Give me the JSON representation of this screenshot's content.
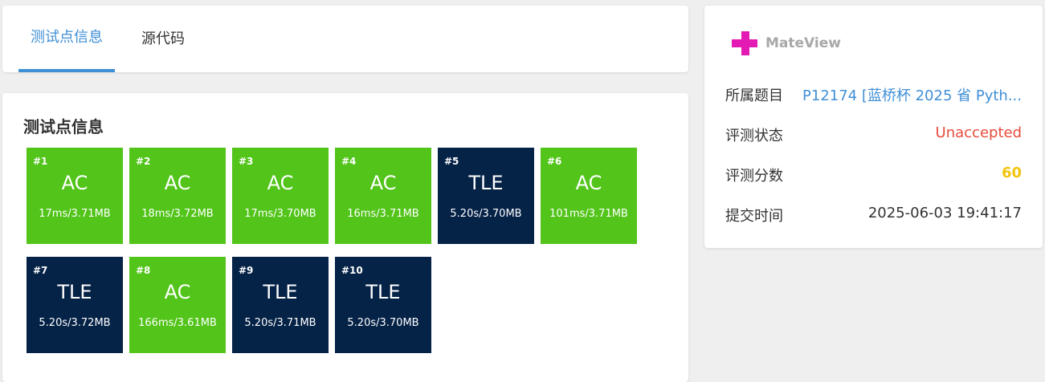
{
  "tabs": [
    {
      "label": "测试点信息",
      "active": true
    },
    {
      "label": "源代码",
      "active": false
    }
  ],
  "section_title": "测试点信息",
  "colors": {
    "ac": "#52c41a",
    "tle": "#052247",
    "accent": "#3f8fd6",
    "unaccepted": "#e74c3c",
    "score": "#f1c40f"
  },
  "test_cases": [
    {
      "num": "#1",
      "status": "AC",
      "meta": "17ms/3.71MB"
    },
    {
      "num": "#2",
      "status": "AC",
      "meta": "18ms/3.72MB"
    },
    {
      "num": "#3",
      "status": "AC",
      "meta": "17ms/3.70MB"
    },
    {
      "num": "#4",
      "status": "AC",
      "meta": "16ms/3.71MB"
    },
    {
      "num": "#5",
      "status": "TLE",
      "meta": "5.20s/3.70MB"
    },
    {
      "num": "#6",
      "status": "AC",
      "meta": "101ms/3.71MB"
    },
    {
      "num": "#7",
      "status": "TLE",
      "meta": "5.20s/3.72MB"
    },
    {
      "num": "#8",
      "status": "AC",
      "meta": "166ms/3.61MB"
    },
    {
      "num": "#9",
      "status": "TLE",
      "meta": "5.20s/3.71MB"
    },
    {
      "num": "#10",
      "status": "TLE",
      "meta": "5.20s/3.70MB"
    }
  ],
  "info": {
    "logo_text": "MateView",
    "problem_label": "所属题目",
    "problem_value": "P12174 [蓝桥杯 2025 省 Pyth...",
    "status_label": "评测状态",
    "status_value": "Unaccepted",
    "score_label": "评测分数",
    "score_value": "60",
    "time_label": "提交时间",
    "time_value": "2025-06-03 19:41:17"
  }
}
